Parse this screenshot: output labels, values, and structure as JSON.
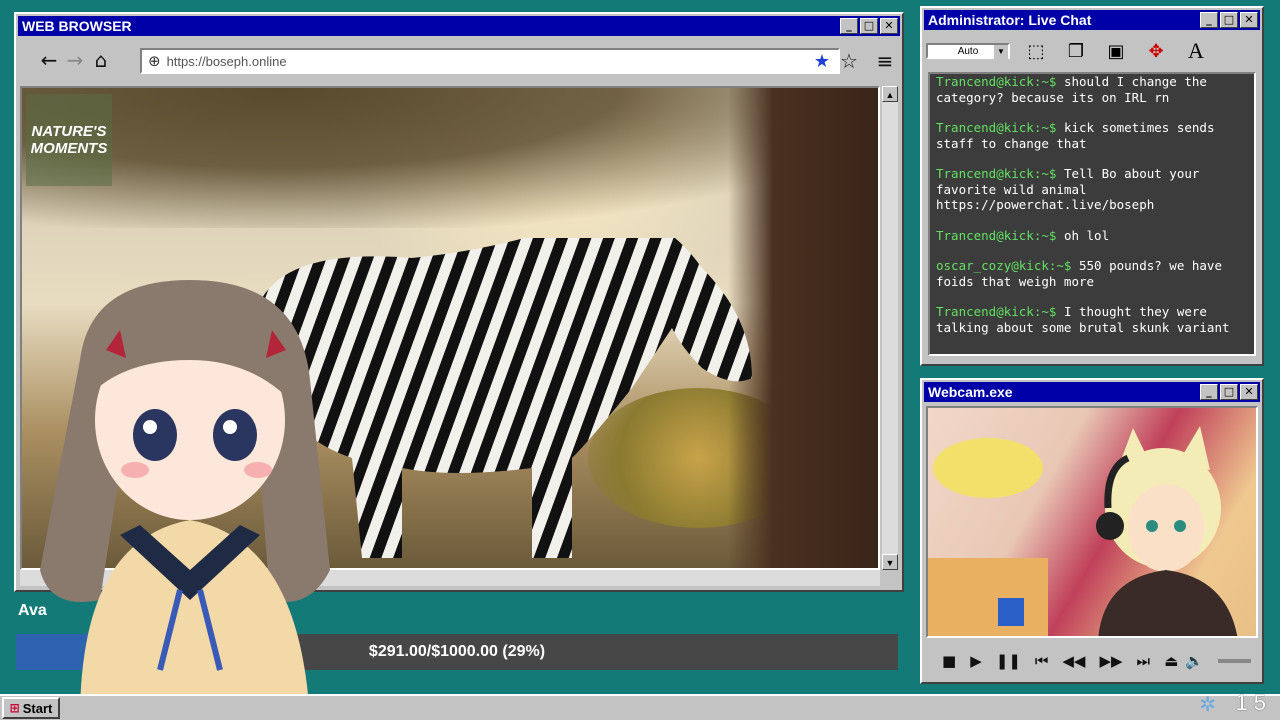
{
  "browser": {
    "title": "WEB BROWSER",
    "url": "https://boseph.online",
    "badge_text": "NATURE'S MOMENTS"
  },
  "chat": {
    "title": "Administrator: Live Chat",
    "font_size_combo": "Auto",
    "messages": [
      {
        "user": "Trancend@kick:~$",
        "text": "should I change the category? because its on IRL rn"
      },
      {
        "user": "Trancend@kick:~$",
        "text": "kick sometimes sends staff to change that"
      },
      {
        "user": "Trancend@kick:~$",
        "text": "Tell Bo about your favorite wild animal https://powerchat.live/boseph"
      },
      {
        "user": "Trancend@kick:~$",
        "text": "oh lol"
      },
      {
        "user": "oscar_cozy@kick:~$",
        "text": "550 pounds? we have foids that weigh more"
      },
      {
        "user": "Trancend@kick:~$",
        "text": "I thought they were talking about some brutal skunk variant"
      }
    ]
  },
  "webcam": {
    "title": "Webcam.exe"
  },
  "donation": {
    "label": "Ava",
    "text": "$291.00/$1000.00 (29%)",
    "fraction": 0.29
  },
  "taskbar": {
    "start_label": "Start",
    "clock": "15"
  },
  "window_buttons": {
    "minimize": "_",
    "maximize": "□",
    "close": "✕"
  },
  "colors": {
    "desktop": "#137a78",
    "titlebar": "#0000a8",
    "chat_bg": "#3c3c3c",
    "chat_user": "#62e062",
    "progress_fill": "#2e63b0"
  }
}
